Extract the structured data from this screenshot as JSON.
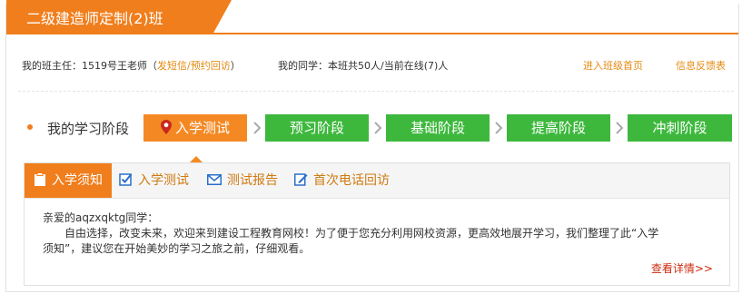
{
  "header": {
    "class_title": "二级建造师定制(2)班"
  },
  "info": {
    "teacher_label": "我的班主任：1519号王老师（",
    "send_sms": "发短信",
    "slash": "/",
    "book_callback": "预约回访",
    "close_paren": "）",
    "classmates": "我的同学：本班共50人/当前在线(7)人",
    "enter_home": "进入班级首页",
    "feedback": "信息反馈表"
  },
  "stages": {
    "label": "我的学习阶段",
    "items": [
      {
        "label": "入学测试",
        "active": true
      },
      {
        "label": "预习阶段",
        "active": false
      },
      {
        "label": "基础阶段",
        "active": false
      },
      {
        "label": "提高阶段",
        "active": false
      },
      {
        "label": "冲刺阶段",
        "active": false
      }
    ]
  },
  "tabs": [
    {
      "label": "入学须知",
      "icon": "clipboard-icon"
    },
    {
      "label": "入学测试",
      "icon": "checkbox-icon"
    },
    {
      "label": "测试报告",
      "icon": "envelope-icon"
    },
    {
      "label": "首次电话回访",
      "icon": "pencil-icon"
    }
  ],
  "content": {
    "greeting": "亲爱的aqzxqktg同学：",
    "body_1": "自由选择，改变未来，欢迎来到建设工程教育网校！为了便于您充分利用网校资源，更高效地展开学习，我们整理了此“入学",
    "body_2": "须知”，建议您在开始美妙的学习之旅之前，仔细观看。",
    "more": "查看详情>>"
  },
  "colors": {
    "accent": "#f07e1c",
    "stage_green": "#3db83d",
    "link": "#e38a10",
    "more": "#cc2b10"
  }
}
